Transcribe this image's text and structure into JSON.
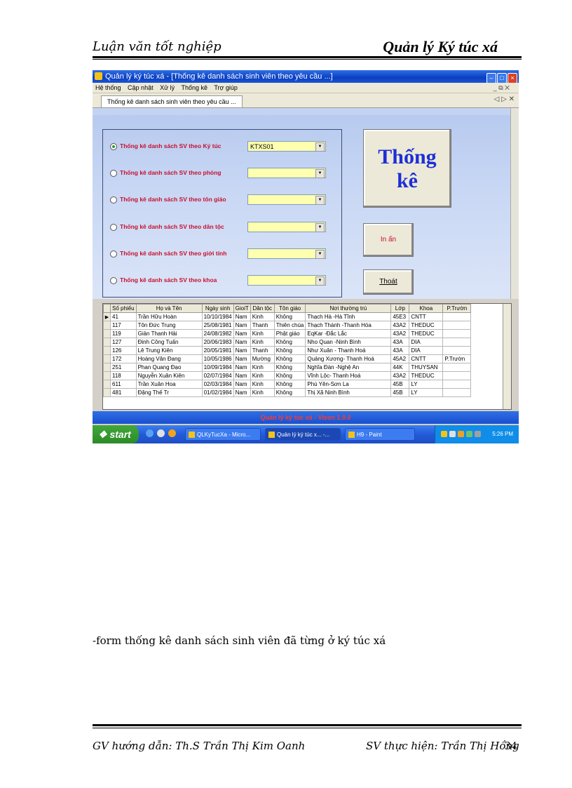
{
  "header": {
    "left": "Luận văn tốt nghiệp",
    "right": "Quản lý Ký túc xá"
  },
  "window": {
    "title": "Quản lý ký túc xá - [Thống kê danh sách sinh viên theo yêu cầu ...]",
    "menu": [
      "Hệ thống",
      "Cập nhật",
      "Xử lý",
      "Thống kê",
      "Trợ giúp"
    ],
    "menu_right": "_ ⧉ ✕",
    "tab": "Thống kê danh sách sinh viên theo yêu cầu ...",
    "tab_right": "◁ ▷ ✕"
  },
  "form": {
    "options": [
      {
        "label": "Thống kê danh sách SV theo Ký túc",
        "value": "KTXS01",
        "selected": true
      },
      {
        "label": "Thống kê danh sách SV theo phòng",
        "value": ""
      },
      {
        "label": "Thống kê danh sách SV theo tôn giáo",
        "value": ""
      },
      {
        "label": "Thống kê danh sách SV theo dân tộc",
        "value": ""
      },
      {
        "label": "Thống kê danh sách SV theo giới tính",
        "value": ""
      },
      {
        "label": "Thống kê danh sách SV theo khoa",
        "value": ""
      }
    ],
    "big_button_line1": "Thống",
    "big_button_line2": "kê",
    "print_button": "In ấn",
    "exit_button": "Thoát"
  },
  "grid": {
    "columns": [
      "Số phiếu",
      "Họ và Tên",
      "Ngày sinh",
      "GioiT",
      "Dân tộc",
      "Tôn giáo",
      "Nơi thường trú",
      "Lớp",
      "Khoa",
      "P.Trườn"
    ],
    "rows": [
      [
        "41",
        "Trần Hữu Hoàn",
        "10/10/1984",
        "Nam",
        "Kinh",
        "Không",
        "Thạch Hà -Hà Tĩnh",
        "45E3",
        "CNTT",
        ""
      ],
      [
        "117",
        "Tôn Đức Trung",
        "25/08/1981",
        "Nam",
        "Thanh",
        "Thiên chúa",
        "Thạch Thành -Thanh Hóa",
        "43A2",
        "THEDUC",
        ""
      ],
      [
        "119",
        "Giản Thanh Hải",
        "24/08/1982",
        "Nam",
        "Kinh",
        "Phật giáo",
        "EqKar -Đắc Lắc",
        "43A2",
        "THEDUC",
        ""
      ],
      [
        "127",
        "Đinh Công Tuấn",
        "20/06/1983",
        "Nam",
        "Kinh",
        "Không",
        "Nho Quan -Ninh Bình",
        "43A",
        "DIA",
        ""
      ],
      [
        "126",
        "Lê Trung Kiên",
        "20/05/1981",
        "Nam",
        "Thanh",
        "Không",
        "Như Xuân - Thanh Hoá",
        "43A",
        "DIA",
        ""
      ],
      [
        "172",
        "Hoàng Văn Đang",
        "10/05/1986",
        "Nam",
        "Mường",
        "Không",
        "Quảng Xương- Thanh Hoá",
        "45A2",
        "CNTT",
        "P.Trườn"
      ],
      [
        "251",
        "Phan Quang Đạo",
        "10/09/1984",
        "Nam",
        "Kinh",
        "Không",
        "Nghĩa Đàn -Nghệ An",
        "44K",
        "THUYSAN",
        ""
      ],
      [
        "118",
        "Nguyễn Xuân Kiên",
        "02/07/1984",
        "Nam",
        "Kinh",
        "Không",
        "Vĩnh Lộc- Thanh Hoá",
        "43A2",
        "THEDUC",
        ""
      ],
      [
        "611",
        "Trần Xuân Hoa",
        "02/03/1984",
        "Nam",
        "Kinh",
        "Không",
        "Phù Yên-Sơn La",
        "45B",
        "LY",
        ""
      ],
      [
        "481",
        "Đặng Thế Tr",
        "01/02/1984",
        "Nam",
        "Kinh",
        "Không",
        "Thị Xã Ninh Bình",
        "45B",
        "LY",
        ""
      ]
    ]
  },
  "status_text": "Quản lý ký túc xá - Vison 1.0.0",
  "taskbar": {
    "start": "start",
    "buttons": [
      "QLKyTucXa - Micro...",
      "Quản lý ký túc x... -...",
      "H9 - Paint"
    ],
    "clock": "5:26 PM"
  },
  "caption": "-form thống kê danh sách sinh viên đã từng ở ký túc xá",
  "footer": {
    "left": "GV hướng  dẫn: Th.S  Trần Thị Kim Oanh",
    "right": "SV thực hiện: Trần Thị Hồng",
    "page": "34"
  }
}
